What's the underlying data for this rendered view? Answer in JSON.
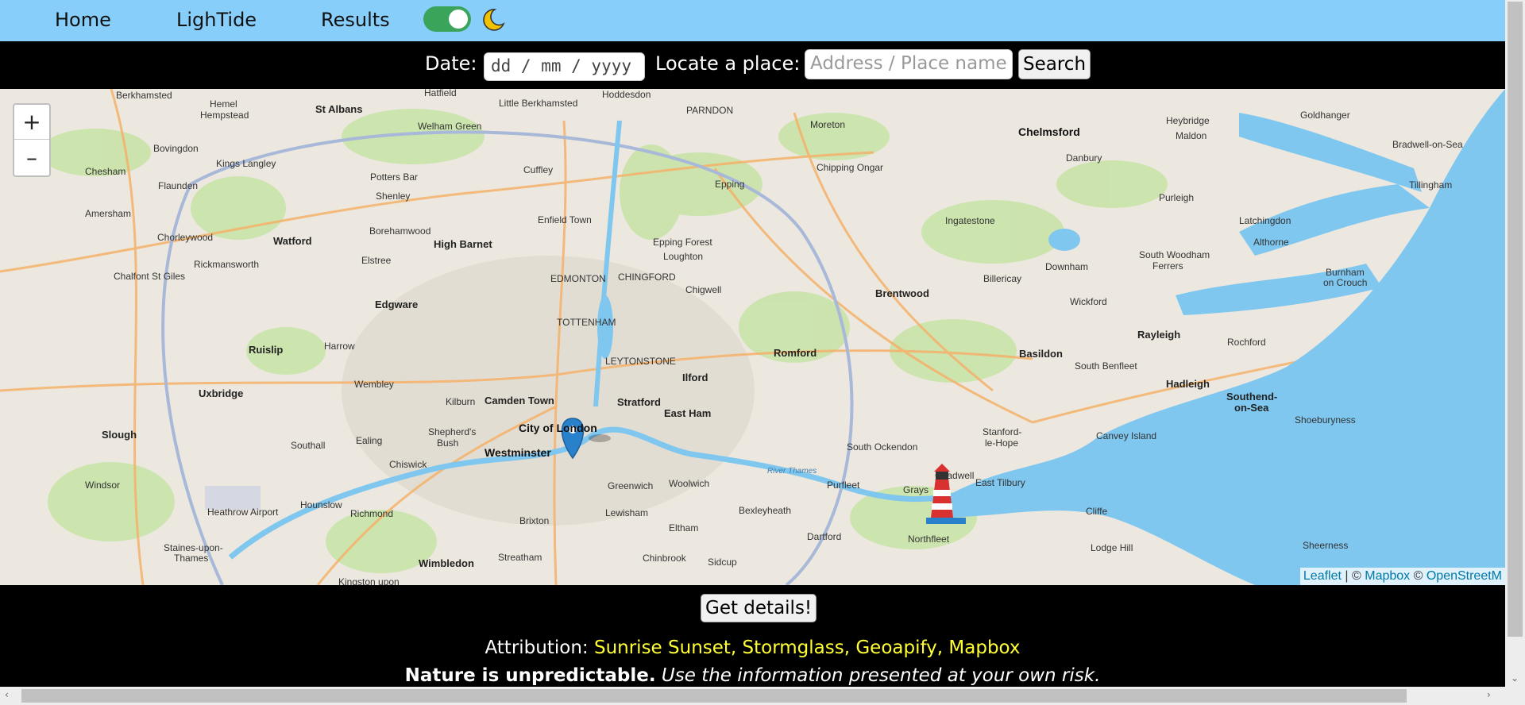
{
  "nav": {
    "home": "Home",
    "lightide": "LighTide",
    "results": "Results"
  },
  "theme_toggle": {
    "state": "on",
    "icon": "moon-icon"
  },
  "search": {
    "date_label": "Date:",
    "date_placeholder": "dd / mm / yyyy",
    "place_label": "Locate a place:",
    "place_placeholder": "Address / Place name",
    "search_button": "Search"
  },
  "map": {
    "zoom_in": "+",
    "zoom_out": "–",
    "attribution_leaflet": "Leaflet",
    "attribution_sep1": " | © ",
    "attribution_mapbox": "Mapbox",
    "attribution_sep2": " © ",
    "attribution_osm": "OpenStreetM",
    "places": {
      "berkhamsted": "Berkhamsted",
      "hemel": "Hemel",
      "hempstead": "Hempstead",
      "st_albans": "St Albans",
      "welham_green": "Welham Green",
      "hatfield": "Hatfield",
      "little_berkhamsted": "Little Berkhamsted",
      "hoddesdon": "Hoddesdon",
      "great_parndon": "PARNDON",
      "moreton": "Moreton",
      "chelmsford": "Chelmsford",
      "heybridge": "Heybridge",
      "goldhanger": "Goldhanger",
      "maldon": "Maldon",
      "bradwell": "Bradwell-on-Sea",
      "bovingdon": "Bovingdon",
      "kings_langley": "Kings Langley",
      "chesham": "Chesham",
      "potters_bar": "Potters Bar",
      "cuffley": "Cuffley",
      "epping": "Epping",
      "chipping_ongar": "Chipping Ongar",
      "danbury": "Danbury",
      "tillingham": "Tillingham",
      "amersham": "Amersham",
      "flaunden": "Flaunden",
      "shenley": "Shenley",
      "watford": "Watford",
      "borehamwood": "Borehamwood",
      "high_barnet": "High Barnet",
      "enfield_town": "Enfield Town",
      "epping_forest": "Epping Forest",
      "loughton": "Loughton",
      "ingatestone": "Ingatestone",
      "purleigh": "Purleigh",
      "latchingdon": "Latchingdon",
      "chorleywood": "Chorleywood",
      "rickmansworth": "Rickmansworth",
      "elstree": "Elstree",
      "edmonton": "EDMONTON",
      "chingford": "CHINGFORD",
      "chigwell": "Chigwell",
      "downham": "Downham",
      "south_woodham": "South Woodham",
      "ferrers": "Ferrers",
      "althorne": "Althorne",
      "burnham": "Burnham",
      "on_crouch": "on Crouch",
      "chalfont": "Chalfont St Giles",
      "edgware": "Edgware",
      "tottenham": "TOTTENHAM",
      "brentwood": "Brentwood",
      "billericay": "Billericay",
      "wickford": "Wickford",
      "harrow": "Harrow",
      "romford": "Romford",
      "rayleigh": "Rayleigh",
      "rochford": "Rochford",
      "ruislip": "Ruislip",
      "ilford": "Ilford",
      "basildon": "Basildon",
      "south_benfleet": "South Benfleet",
      "wembley": "Wembley",
      "leytonstone": "LEYTONSTONE",
      "hadleigh": "Hadleigh",
      "uxbridge": "Uxbridge",
      "kilburn": "Kilburn",
      "camden_town": "Camden Town",
      "stratford": "Stratford",
      "southend": "Southend-",
      "on_sea": "on-Sea",
      "shoeburyness": "Shoeburyness",
      "east_ham": "East Ham",
      "slough": "Slough",
      "southall": "Southall",
      "ealing": "Ealing",
      "shepherds_bush": "Shepherd's",
      "bush": "Bush",
      "city_of_london": "City of London",
      "westminster": "Westminster",
      "south_ockendon": "South Ockendon",
      "stanford": "Stanford-",
      "le_hope": "le-Hope",
      "canvey": "Canvey Island",
      "chiswick": "Chiswick",
      "greenwich": "Greenwich",
      "woolwich": "Woolwich",
      "chadwell": "Chadwell",
      "windsor": "Windsor",
      "hounslow": "Hounslow",
      "purfleet": "Purfleet",
      "grays": "Grays",
      "east_tilbury": "East Tilbury",
      "heathrow": "Heathrow Airport",
      "richmond": "Richmond",
      "lewisham": "Lewisham",
      "bexleyheath": "Bexleyheath",
      "brixton": "Brixton",
      "eltham": "Eltham",
      "cliffe": "Cliffe",
      "northfleet": "Northfleet",
      "dartford": "Dartford",
      "staines": "Staines-upon-",
      "thames": "Thames",
      "streatham": "Streatham",
      "chinbrook": "Chinbrook",
      "sidcup": "Sidcup",
      "lodge_hill": "Lodge Hill",
      "wimbledon": "Wimbledon",
      "sheerness": "Sheerness",
      "kingston": "Kingston upon",
      "river_thames": "River Thames"
    }
  },
  "details_button": "Get details!",
  "attribution": {
    "label": "Attribution:",
    "sources": "Sunrise Sunset, Stormglass, Geoapify, Mapbox"
  },
  "notice": {
    "bold": "Nature is unpredictable.",
    "italic": "Use the information presented at your own risk."
  },
  "colors": {
    "nav_bg": "#87cefa",
    "toggle_on": "#3aa55a",
    "attribution_link": "#ffff33",
    "water": "#7fc7ef",
    "marker": "#2a81cb"
  }
}
